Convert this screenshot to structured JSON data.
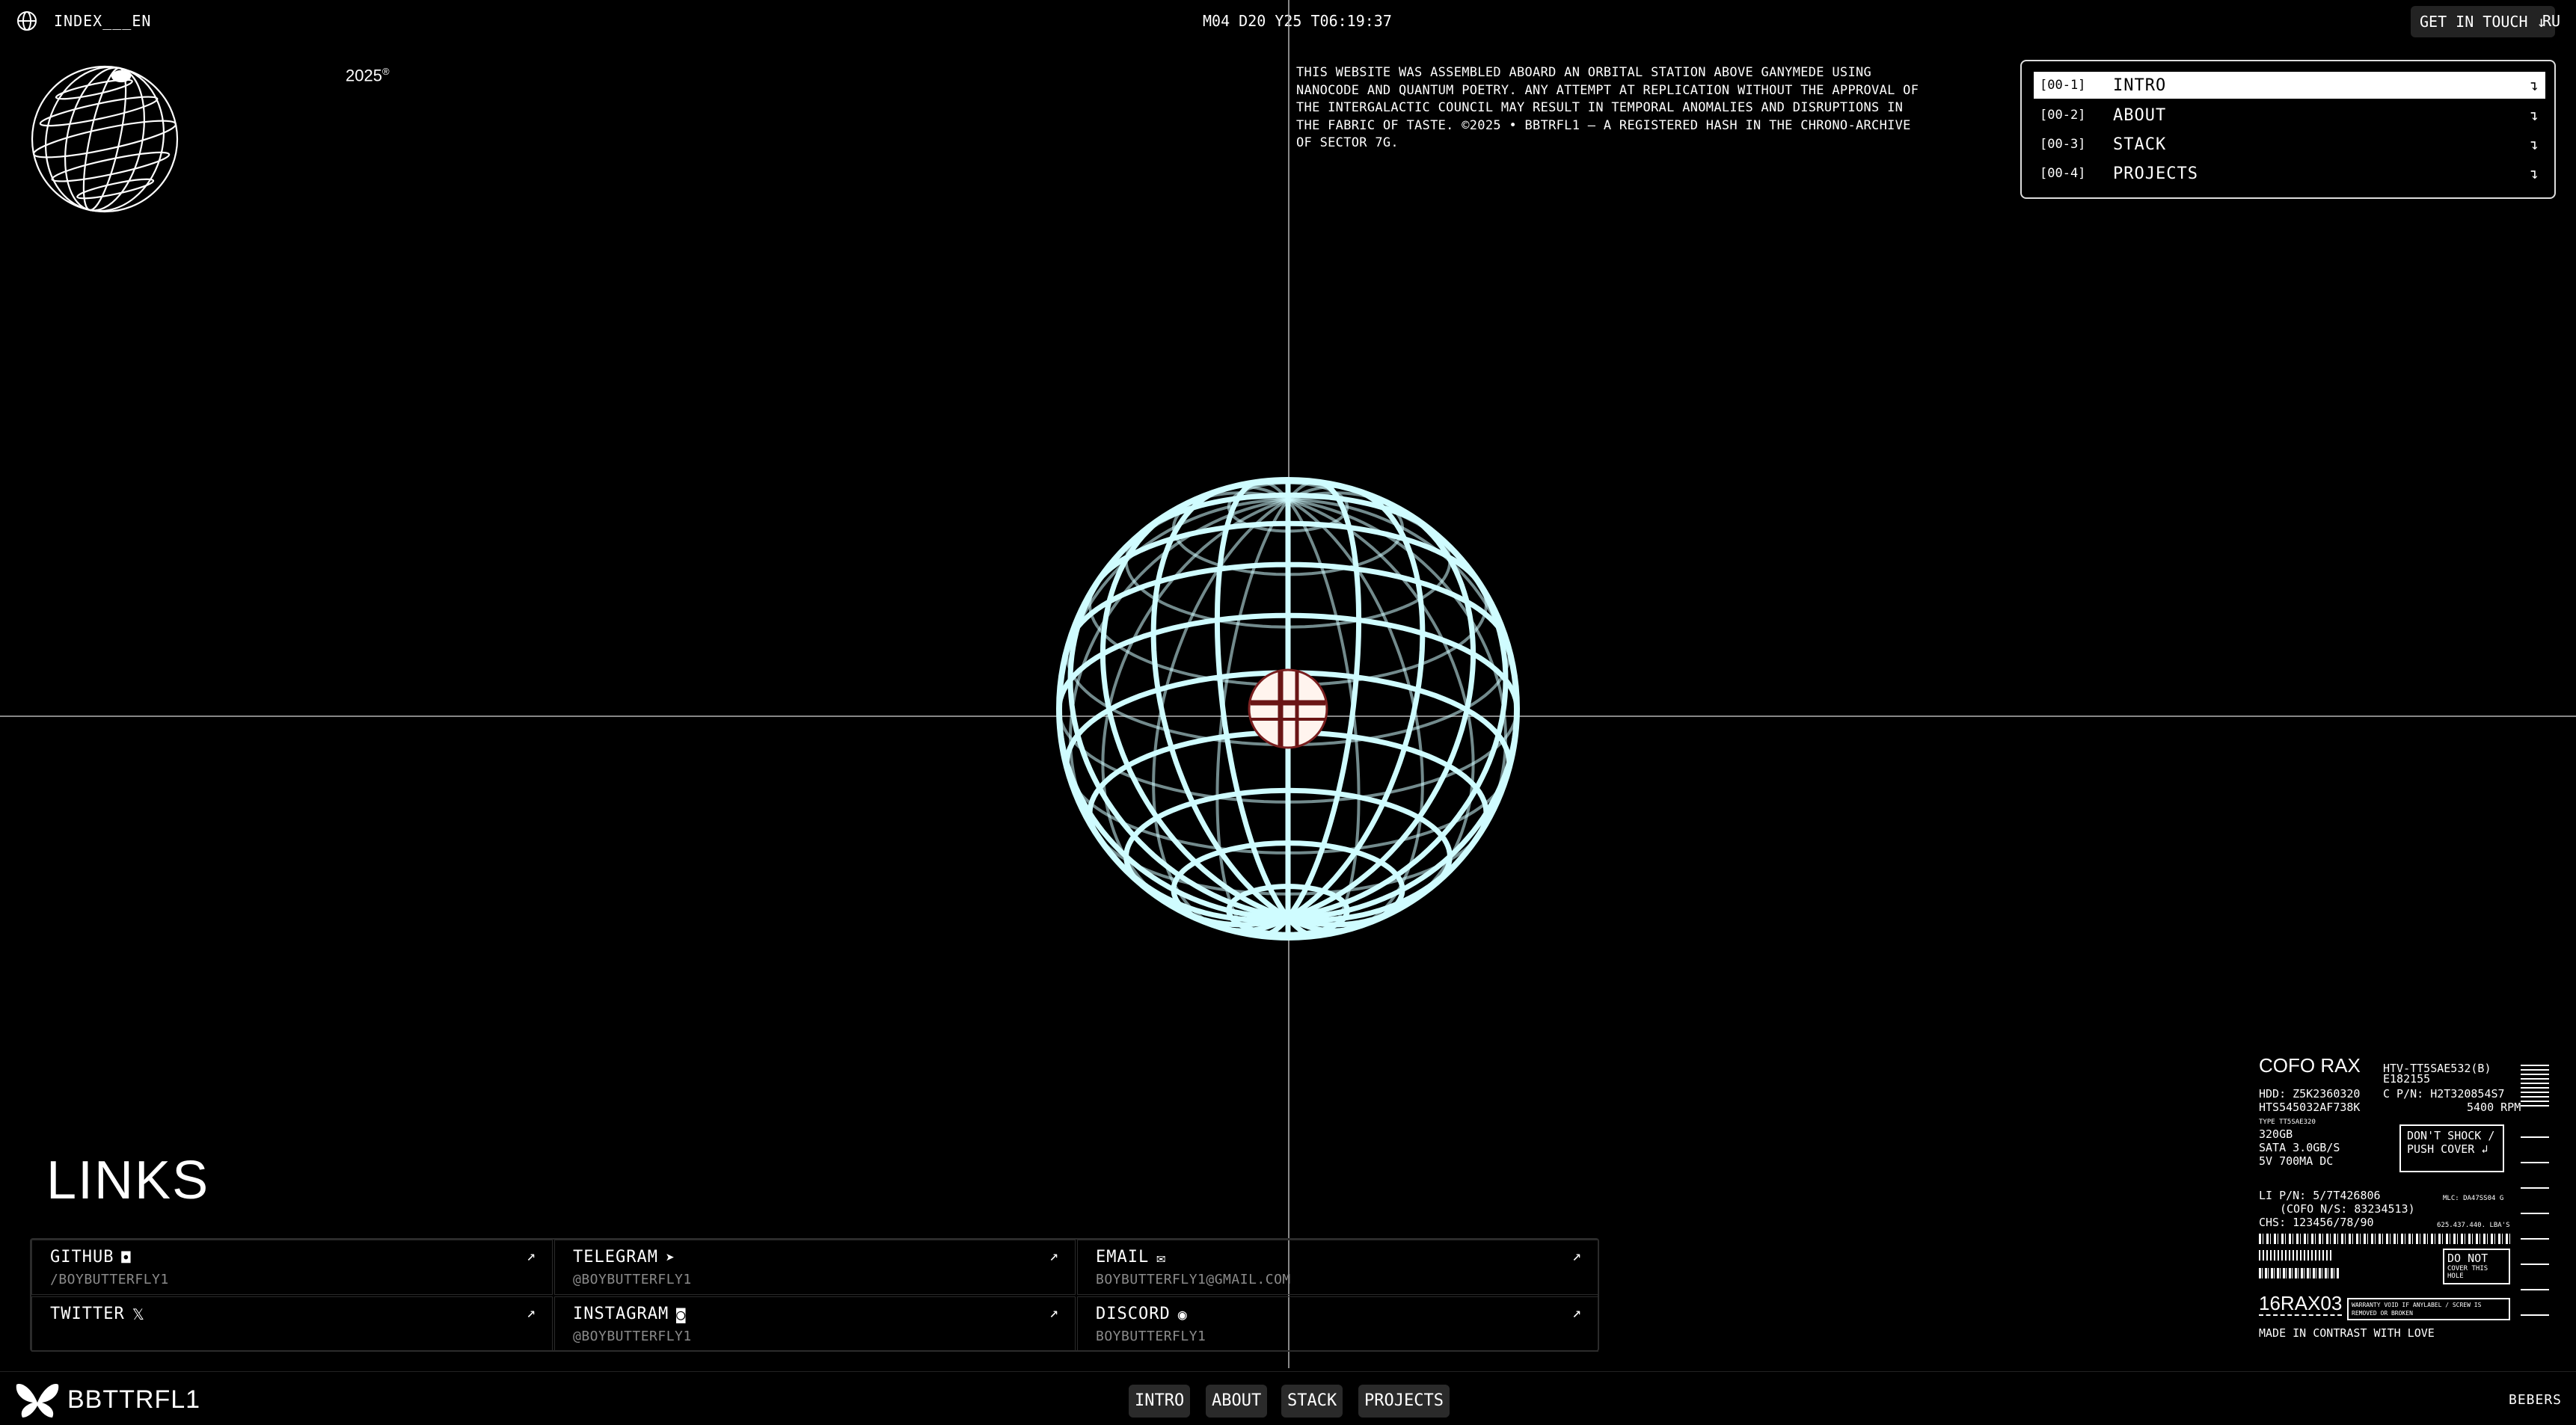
{
  "header": {
    "index_label": "INDEX___EN",
    "clock": "M04 D20 Y25 T06:19:37",
    "contact_label": "GET IN TOUCH",
    "contact_arrow": "↓",
    "lang": "RU"
  },
  "hero": {
    "year": "2025",
    "year_mark": "®",
    "disclaimer": "THIS WEBSITE WAS ASSEMBLED ABOARD AN ORBITAL STATION ABOVE GANYMEDE USING NANOCODE AND QUANTUM POETRY. ANY ATTEMPT AT REPLICATION WITHOUT THE APPROVAL OF THE INTERGALACTIC COUNCIL MAY RESULT IN TEMPORAL ANOMALIES AND DISRUPTIONS IN THE FABRIC OF TASTE. ©2025 • BBTRFL1 — A REGISTERED HASH IN THE CHRONO-ARCHIVE OF SECTOR 7G.",
    "globe_color": "#cffcff"
  },
  "nav": {
    "items": [
      {
        "num": "[00-1]",
        "label": "INTRO",
        "active": true
      },
      {
        "num": "[00-2]",
        "label": "ABOUT",
        "active": false
      },
      {
        "num": "[00-3]",
        "label": "STACK",
        "active": false
      },
      {
        "num": "[00-4]",
        "label": "PROJECTS",
        "active": false
      }
    ],
    "arrow": "↴"
  },
  "links": {
    "title": "LINKS",
    "arrow": "↗",
    "items": [
      {
        "name": "GITHUB",
        "icon": "github-icon",
        "handle": "/BOYBUTTERFLY1"
      },
      {
        "name": "TELEGRAM",
        "icon": "telegram-icon",
        "handle": "@BOYBUTTERFLY1"
      },
      {
        "name": "EMAIL",
        "icon": "email-icon",
        "handle": "BOYBUTTERFLY1@GMAIL.COM"
      },
      {
        "name": "TWITTER",
        "icon": "x-icon",
        "handle": ""
      },
      {
        "name": "INSTAGRAM",
        "icon": "instagram-icon",
        "handle": "@BOYBUTTERFLY1"
      },
      {
        "name": "DISCORD",
        "icon": "discord-icon",
        "handle": "BOYBUTTERFLY1"
      }
    ]
  },
  "sticker": {
    "brand": "COFO RAX",
    "model": "HTV-TT5SAE532(B)",
    "model2": "E182155",
    "hdd": "HDD: Z5K2360320",
    "cpn": "C P/N: H2T320854S7",
    "hts": "HTS545032AF738K",
    "rpm": "5400 RPM",
    "type": "TYPE TT5SAE320",
    "cap": "320GB",
    "sata": "SATA 3.0GB/S",
    "power": "5V 700MA DC",
    "shock": "DON'T SHOCK / PUSH COVER ↲",
    "lipn": "LI P/N: 5/7T426806",
    "mlc": "MLC: DA47SS04 G",
    "cofo_ns": "(COFO N/S: 83234513)",
    "chs": "CHS: 123456/78/90",
    "chs2": "625.437.440. LBA'S",
    "code": "16RAX03",
    "donot": "DO NOT",
    "cover": "COVER THIS HOLE",
    "warranty": "WARRANTY VOID IF ANYLABEL / SCREW IS REMOVED OR BROKEN",
    "made": "MADE IN CONTRAST WITH LOVE"
  },
  "footer": {
    "brand": "BBTTRFL1",
    "tabs": [
      "INTRO",
      "ABOUT",
      "STACK",
      "PROJECTS"
    ],
    "credit": "BEBERS"
  }
}
